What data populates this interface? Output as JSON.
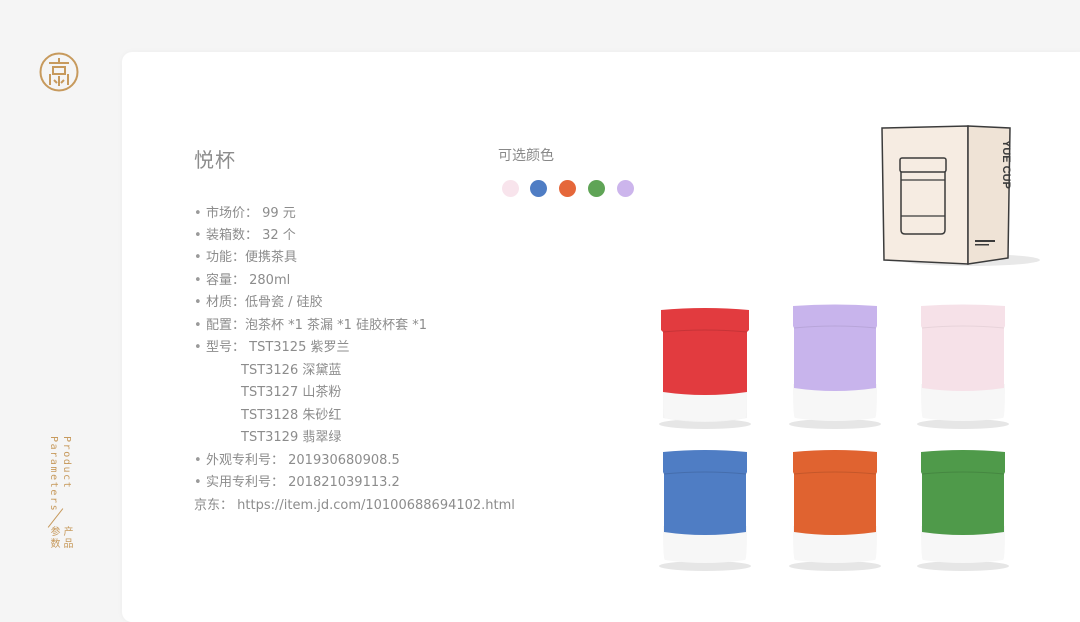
{
  "brand": {
    "side_en_1": "Product",
    "side_en_2": "Parameters",
    "side_cn_1": "产品",
    "side_cn_2": "参数"
  },
  "product": {
    "name": "悦杯",
    "params": [
      {
        "bullet": "•",
        "text": "市场价：  99  元"
      },
      {
        "bullet": "•",
        "text": "装箱数：  32  个"
      },
      {
        "bullet": "•",
        "text": "功能：便携茶具"
      },
      {
        "bullet": "•",
        "text": "容量：  280ml"
      },
      {
        "bullet": "•",
        "text": "材质：低骨瓷  /  硅胶"
      },
      {
        "bullet": "•",
        "text": "配置：泡茶杯 *1    茶漏 *1    硅胶杯套 *1"
      },
      {
        "bullet": "•",
        "text": "型号：  TST3125    紫罗兰"
      },
      {
        "bullet": "",
        "text": "TST3126    深黛蓝"
      },
      {
        "bullet": "",
        "text": "TST3127    山茶粉"
      },
      {
        "bullet": "",
        "text": "TST3128    朱砂红"
      },
      {
        "bullet": "",
        "text": "TST3129    翡翠绿"
      },
      {
        "bullet": "•",
        "text": "外观专利号：  201930680908.5"
      },
      {
        "bullet": "•",
        "text": "实用专利号：  201821039113.2"
      },
      {
        "bullet": "",
        "text": "京东：  https://item.jd.com/10100688694102.html"
      }
    ]
  },
  "colors": {
    "label": "可选颜色",
    "swatches": [
      "#f8e4ec",
      "#4f7dc4",
      "#e5673a",
      "#5fa456",
      "#ccb5ec"
    ]
  },
  "package": {
    "brand_text": "YUE CUP",
    "accent": "#c79a5d"
  },
  "cups": [
    {
      "color": "#e23b3f"
    },
    {
      "color": "#c8b4ec"
    },
    {
      "color": "#f6e1e8"
    },
    {
      "color": "#4f7dc4"
    },
    {
      "color": "#e06330"
    },
    {
      "color": "#4f9a4a"
    }
  ]
}
